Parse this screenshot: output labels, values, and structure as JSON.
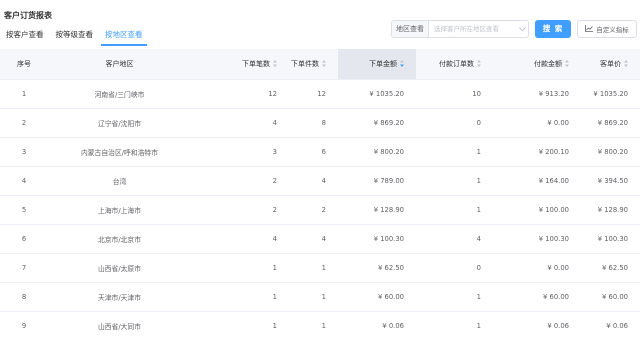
{
  "page": {
    "title": "客户订货报表"
  },
  "tabs": [
    {
      "label": "按客户查看",
      "active": false
    },
    {
      "label": "按等级查看",
      "active": false
    },
    {
      "label": "按地区查看",
      "active": true
    }
  ],
  "filter": {
    "prefix": "地区查看",
    "placeholder": "选择客户所在地区查看"
  },
  "buttons": {
    "search": "搜 索",
    "custom_metric": "自定义指标"
  },
  "table": {
    "columns": [
      "序号",
      "客户地区",
      "下单笔数",
      "下单件数",
      "下单金额",
      "付款订单数",
      "付款金额",
      "客单价"
    ],
    "sorted_column": "下单金额",
    "rows": [
      [
        "1",
        "河南省/三门峡市",
        "12",
        "12",
        "¥ 1035.20",
        "10",
        "¥ 913.20",
        "¥ 1035.20"
      ],
      [
        "2",
        "辽宁省/沈阳市",
        "4",
        "8",
        "¥ 869.20",
        "0",
        "¥ 0.00",
        "¥ 869.20"
      ],
      [
        "3",
        "内蒙古自治区/呼和浩特市",
        "3",
        "6",
        "¥ 800.20",
        "1",
        "¥ 200.10",
        "¥ 800.20"
      ],
      [
        "4",
        "台湾",
        "2",
        "4",
        "¥ 789.00",
        "1",
        "¥ 164.00",
        "¥ 394.50"
      ],
      [
        "5",
        "上海市/上海市",
        "2",
        "2",
        "¥ 128.90",
        "1",
        "¥ 100.00",
        "¥ 128.90"
      ],
      [
        "6",
        "北京市/北京市",
        "4",
        "4",
        "¥ 100.30",
        "4",
        "¥ 100.30",
        "¥ 100.30"
      ],
      [
        "7",
        "山西省/太原市",
        "1",
        "1",
        "¥ 62.50",
        "0",
        "¥ 0.00",
        "¥ 62.50"
      ],
      [
        "8",
        "天津市/天津市",
        "1",
        "1",
        "¥ 60.00",
        "1",
        "¥ 60.00",
        "¥ 60.00"
      ],
      [
        "9",
        "山西省/大同市",
        "1",
        "1",
        "¥ 0.06",
        "1",
        "¥ 0.06",
        "¥ 0.06"
      ]
    ]
  },
  "colors": {
    "accent": "#409eff",
    "header_bg": "#f5f7fa",
    "sorted_header_bg": "#e4e7ed"
  }
}
